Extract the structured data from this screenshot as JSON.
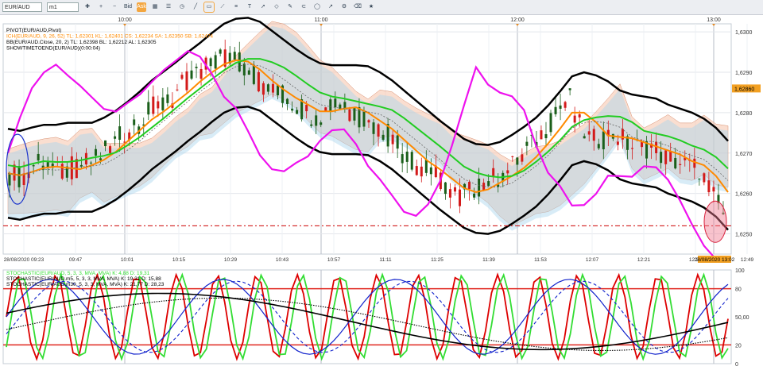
{
  "toolbar": {
    "symbol": "EUR/AUD",
    "timeframe": "m1",
    "icons": [
      "bid-icon",
      "ask-icon",
      "crosshair-icon",
      "zoom-in-icon",
      "zoom-out-icon",
      "period-icon",
      "grid-icon",
      "legend-icon",
      "cursor-icon",
      "line-icon",
      "hline-icon",
      "channel-icon",
      "fib-icon",
      "text-icon",
      "arrow-icon",
      "shape-icon",
      "brush-icon",
      "magnet-icon",
      "ellipse-icon",
      "trend-icon",
      "settings-icon",
      "eraser-icon",
      "star-icon"
    ],
    "bid_label": "Bid",
    "ask_label": "Ask"
  },
  "colors": {
    "candle_up": "#1a5f1a",
    "candle_down": "#d31a1a",
    "pivot": "#000000",
    "ichimoku_orange": "#ff8a00",
    "ichimoku_green": "#22cc22",
    "chikou_magenta": "#ee11ee",
    "cloud_blue": "#a8d4ee",
    "cloud_salmon": "#f6c3aa",
    "level_line": "#cc0000",
    "stoch_red": "#dd0000",
    "stoch_green": "#33dd33",
    "stoch_blue": "#1122cc"
  },
  "chart_data": [
    {
      "type": "candlestick",
      "title": "",
      "symbol": "EUR/AUD",
      "legend": [
        "PIVOT(EUR/AUD,Pivot)",
        "ICH(EUR/AUD, 9, 26, 52) TL: 1,62301 KL: 1,62401 CS: 1,62234 SA: 1,62350 SB: 1,62474",
        "BB(EUR/AUD.Close, 20, 2) TL: 1,62398 BL: 1,62212 AL: 1,62305",
        "SHOWTIMETOEND(EUR/AUD)(0:00:04)"
      ],
      "y_axis_ticks": [
        "1,6300",
        "1,6290",
        "1,6280",
        "1,6270",
        "1,6260",
        "1,6250"
      ],
      "ylim": [
        1.6245,
        1.6302
      ],
      "price_label": "1,62860",
      "last_price": 1.6275,
      "level_line": 1.6252,
      "x_axis_ticks": [
        "28/08/2020 09:23",
        "09:47",
        "10:01",
        "10:15",
        "10:29",
        "10:43",
        "10:57",
        "11:11",
        "11:25",
        "11:39",
        "11:53",
        "12:07",
        "12:21",
        "12:35",
        "12:49"
      ],
      "time_label": "28/08/2020 13:02",
      "top_hour_labels": [
        "10:00",
        "11:00",
        "12:00",
        "13:00"
      ],
      "close_path": [
        1.6265,
        1.6264,
        1.6267,
        1.6268,
        1.6265,
        1.6266,
        1.6267,
        1.6268,
        1.627,
        1.6273,
        1.6276,
        1.6278,
        1.6281,
        1.6282,
        1.6285,
        1.6288,
        1.629,
        1.6292,
        1.6294,
        1.6293,
        1.6291,
        1.6288,
        1.6285,
        1.6284,
        1.6282,
        1.628,
        1.6279,
        1.6282,
        1.6282,
        1.628,
        1.6278,
        1.6276,
        1.6274,
        1.627,
        1.6268,
        1.6266,
        1.6264,
        1.6261,
        1.6259,
        1.6261,
        1.6263,
        1.6264,
        1.6266,
        1.6269,
        1.6272,
        1.6276,
        1.628,
        1.6284,
        1.6276,
        1.6273,
        1.6274,
        1.6275,
        1.6272,
        1.6271,
        1.6272,
        1.6269,
        1.6268,
        1.6267,
        1.6266,
        1.626,
        1.6255
      ]
    },
    {
      "type": "line",
      "title": "",
      "legend": [
        "STOCHASTIC(EUR/AUD, 5, 3, 3, MVA, MVA) K: 4,88 D: 19,31",
        "STOCHASTIC(EUR/AUD.m5, 5, 3, 3, MVA, MVA) K: 19,31 D: 15,88",
        "STOCHASTIC(EUR/AUD.m30, 5, 3, 3, MVA, MVA) K: 21,77 D: 28,23"
      ],
      "y_axis_ticks": [
        "100",
        "80",
        "50,00",
        "20",
        "0"
      ],
      "ylim": [
        0,
        100
      ],
      "levels": [
        80,
        20
      ]
    }
  ]
}
